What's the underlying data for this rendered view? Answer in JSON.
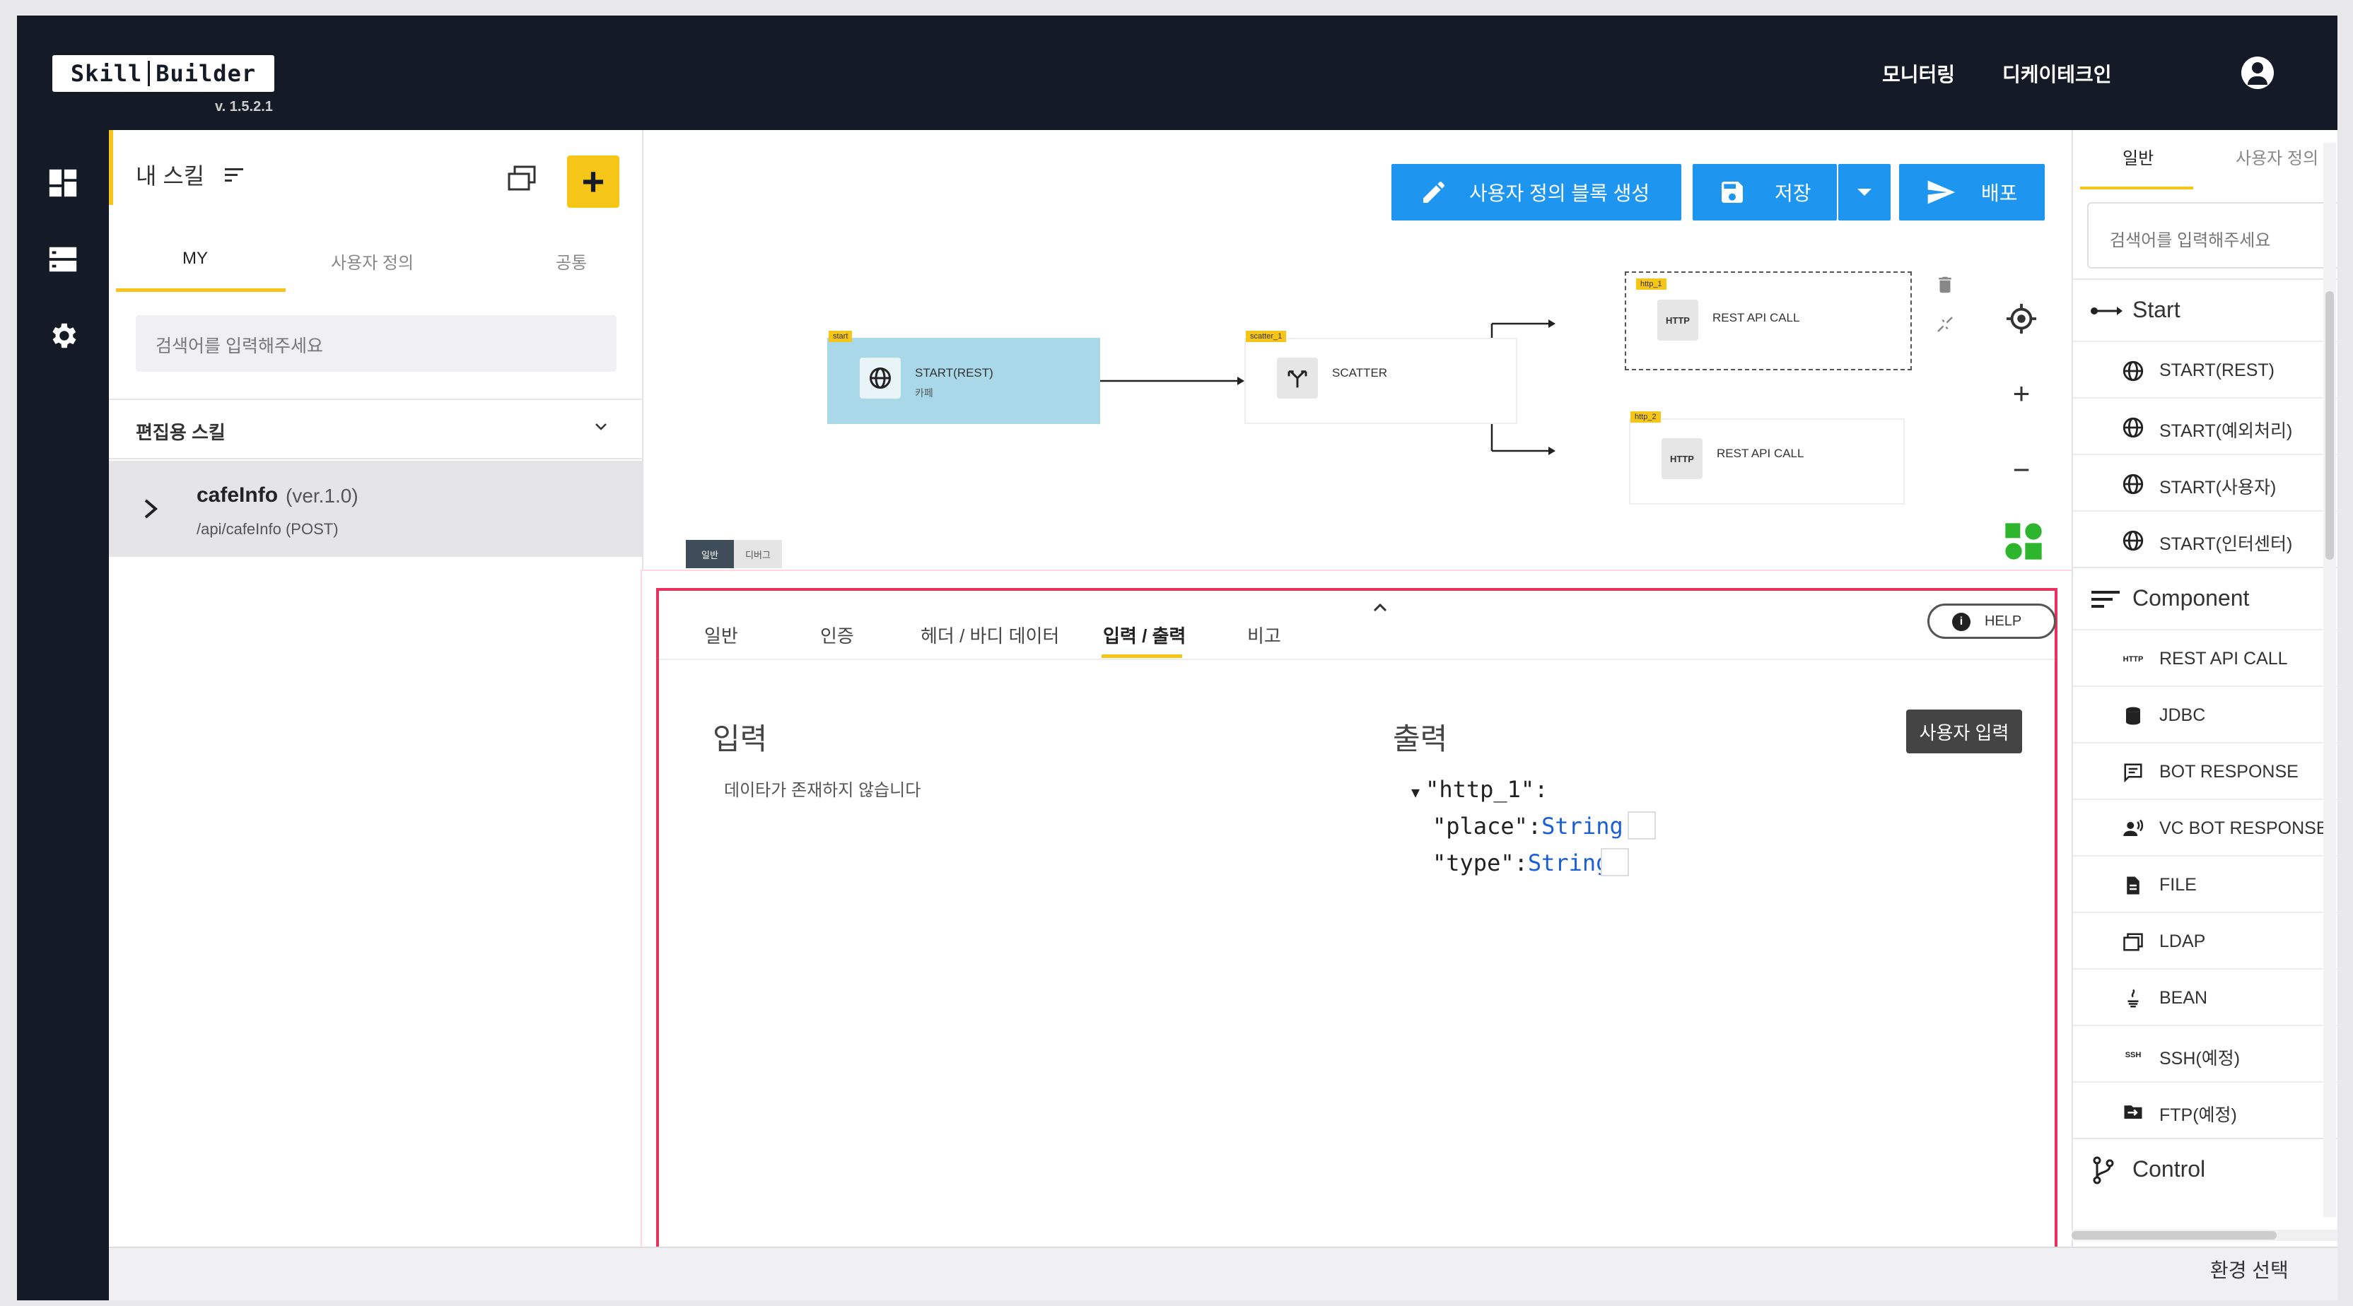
{
  "app": {
    "logo_left": "Skill",
    "logo_right": "Builder",
    "version": "v. 1.5.2.1"
  },
  "topnav": {
    "monitoring": "모니터링",
    "company": "디케이테크인",
    "profile_icon": "user-circle-icon"
  },
  "rail": {
    "icons": [
      "dashboard-icon",
      "server-icon",
      "settings-icon"
    ]
  },
  "left_panel": {
    "title": "내 스킬",
    "tabs": [
      "MY",
      "사용자 정의",
      "공통"
    ],
    "active_tab": "MY",
    "search_placeholder": "검색어를 입력해주세요",
    "group_label": "편집용 스킬",
    "skills": [
      {
        "name": "cafeInfo",
        "version": "(ver.1.0)",
        "path": "/api/cafeInfo (POST)"
      }
    ]
  },
  "toolbar": {
    "custom_block": "사용자 정의 블록 생성",
    "save": "저장",
    "deploy": "배포"
  },
  "canvas": {
    "nodes": [
      {
        "tag": "start",
        "label": "START(REST)",
        "sub": "카페",
        "icon": "globe-icon"
      },
      {
        "tag": "scatter_1",
        "label": "SCATTER",
        "icon": "scatter-icon"
      },
      {
        "tag": "http_1",
        "label": "REST API CALL",
        "icon_text": "HTTP"
      },
      {
        "tag": "http_2",
        "label": "REST API CALL",
        "icon_text": "HTTP"
      }
    ],
    "mode_toggle": [
      "일반",
      "디버그"
    ],
    "active_mode": "일반"
  },
  "detail_panel": {
    "tabs": [
      "일반",
      "인증",
      "헤더 / 바디 데이터",
      "입력 / 출력",
      "비고"
    ],
    "active_tab": "입력 / 출력",
    "help": "HELP",
    "input_title": "입력",
    "input_empty": "데이타가 존재하지 않습니다",
    "output_title": "출력",
    "user_input_button": "사용자 입력",
    "output_tree": {
      "root": "\"http_1\":",
      "fields": [
        {
          "key": "\"place\":",
          "type": "String"
        },
        {
          "key": "\"type\":",
          "type": "String"
        }
      ]
    }
  },
  "right_panel": {
    "tabs": [
      "일반",
      "사용자 정의"
    ],
    "active_tab": "일반",
    "search_placeholder": "검색어를 입력해주세요",
    "sections": [
      {
        "name": "Start",
        "items": [
          "START(REST)",
          "START(예외처리)",
          "START(사용자)",
          "START(인터센터)"
        ]
      },
      {
        "name": "Component",
        "items": [
          "REST API CALL",
          "JDBC",
          "BOT RESPONSE",
          "VC BOT RESPONSE",
          "FILE",
          "LDAP",
          "BEAN",
          "SSH(예정)",
          "FTP(예정)"
        ]
      },
      {
        "name": "Control",
        "items": []
      }
    ]
  },
  "footer": {
    "env_select": "환경 선택"
  },
  "colors": {
    "dark": "#151b26",
    "accent_yellow": "#f5c518",
    "primary_blue": "#1e96ef",
    "start_node": "#a9d9e8",
    "highlight_pink": "#e8315e"
  }
}
